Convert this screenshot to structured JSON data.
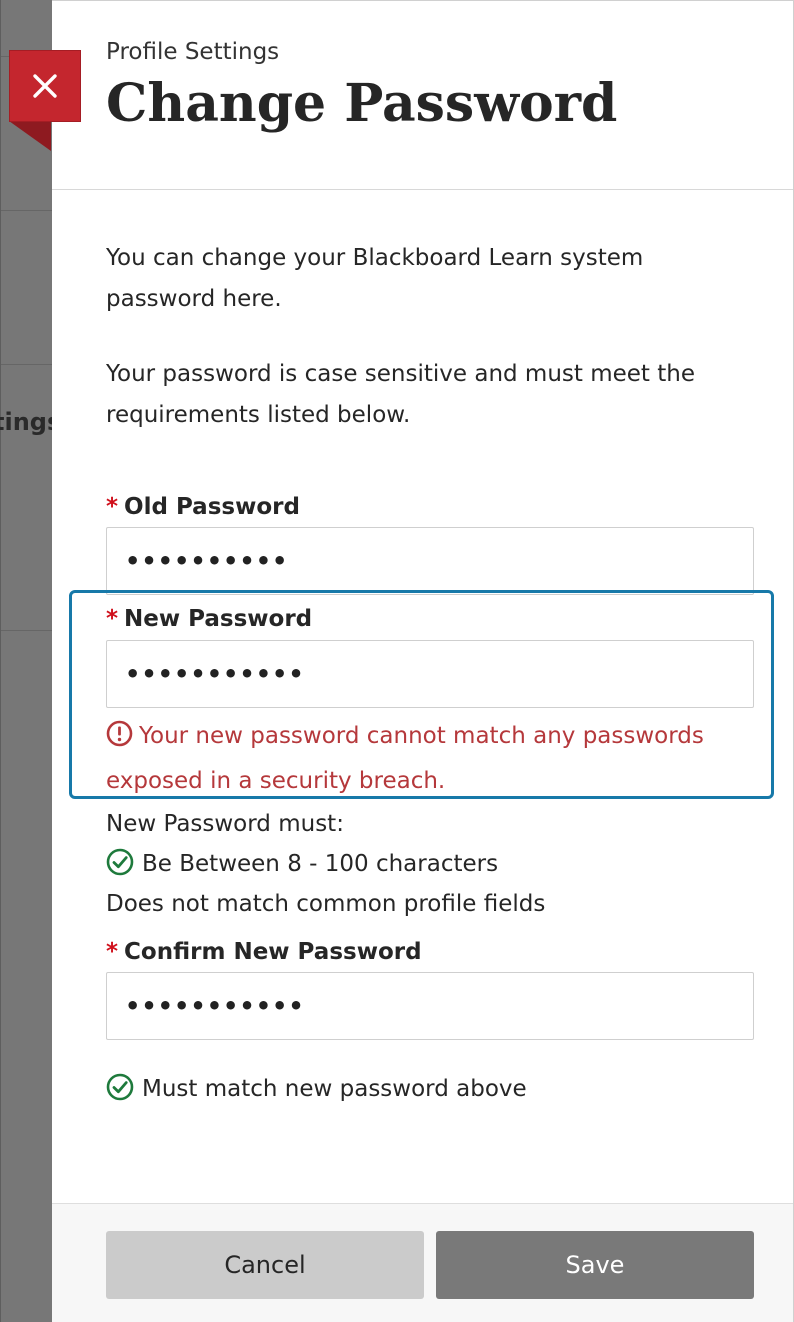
{
  "backdrop": {
    "partial_text": "tings"
  },
  "header": {
    "eyebrow": "Profile Settings",
    "title": "Change Password"
  },
  "intro": {
    "line1": "You can change your Blackboard Learn system password here.",
    "line2": "Your password is case sensitive and must meet the requirements listed below."
  },
  "fields": {
    "required_marker": "*",
    "old_password": {
      "label": "Old Password",
      "value": "••••••••••"
    },
    "new_password": {
      "label": "New Password",
      "value": "•••••••••••",
      "error": "Your new password cannot match any passwords exposed in a security breach."
    },
    "confirm_password": {
      "label": "Confirm New Password",
      "value": "•••••••••••"
    }
  },
  "requirements": {
    "heading": "New Password must:",
    "items": [
      {
        "text": "Be Between 8 - 100 characters",
        "met": true
      },
      {
        "text": "Does not match common profile fields",
        "met": false
      }
    ],
    "confirm_rule": "Must match new password above"
  },
  "footer": {
    "cancel_label": "Cancel",
    "save_label": "Save"
  },
  "colors": {
    "close_red": "#c4262e",
    "focus_blue": "#1779a9",
    "error_red": "#b5383b",
    "success_green": "#1e7a3c",
    "required_red": "#d0101c"
  },
  "icons": {
    "close": "close-icon",
    "error": "error-circle-icon",
    "check": "check-circle-icon"
  }
}
